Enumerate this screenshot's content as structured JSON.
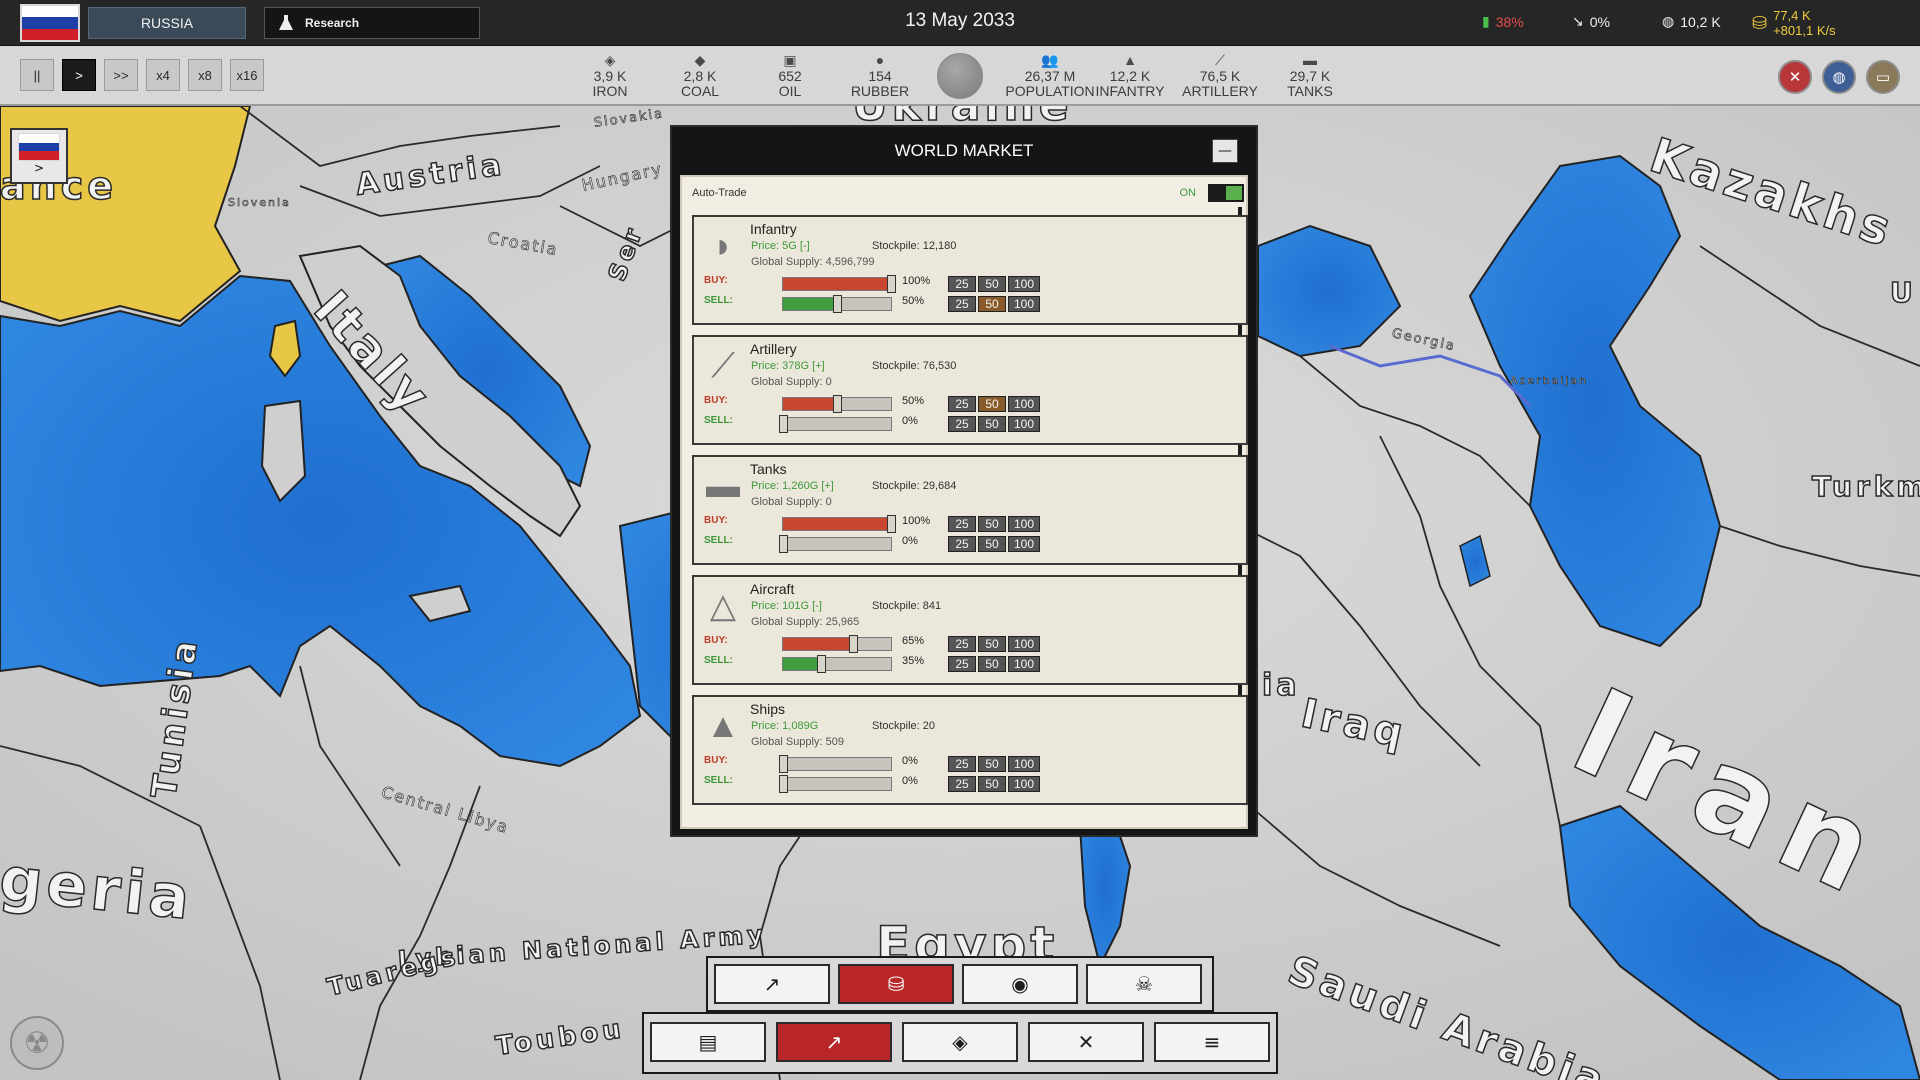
{
  "topbar": {
    "country": "RUSSIA",
    "research_label": "Research",
    "date": "13 May 2033",
    "territory": "38%",
    "growth": "0%",
    "population_short": "10,2 K",
    "money": "77,4 K",
    "money_rate": "+801,1 K/s",
    "colors": {
      "territory": "#e24c4c",
      "money": "#f0cc3a"
    }
  },
  "speed_controls": [
    "||",
    ">",
    ">>",
    "x4",
    "x8",
    "x16"
  ],
  "resources": [
    {
      "value": "3,9 K",
      "label": "IRON",
      "icon": "layers-icon"
    },
    {
      "value": "2,8 K",
      "label": "COAL",
      "icon": "gem-icon"
    },
    {
      "value": "652",
      "label": "OIL",
      "icon": "barrel-icon"
    },
    {
      "value": "154",
      "label": "RUBBER",
      "icon": "drop-icon"
    },
    {
      "value": "26,37 M",
      "label": "POPULATION",
      "icon": "people-icon"
    },
    {
      "value": "12,2 K",
      "label": "INFANTRY",
      "icon": "helmet-icon"
    },
    {
      "value": "76,5 K",
      "label": "ARTILLERY",
      "icon": "cannon-icon"
    },
    {
      "value": "29,7 K",
      "label": "TANKS",
      "icon": "tank-icon"
    }
  ],
  "side_flag": {
    "arrow": ">"
  },
  "map_labels": {
    "france": "ance",
    "austria": "Austria",
    "hungary": "Hungary",
    "slovakia": "Slovakia",
    "croatia": "Croatia",
    "serbia": "Ser",
    "italy": "Italy",
    "kazakhstan": "Kazakhs",
    "georgia": "Georgia",
    "azerbaijan": "Azerbaijan",
    "turkmenistan": "Turkm",
    "iraq": "Iraq",
    "iran": "Iran",
    "syria_frag": "ia",
    "tunisia": "Tunisia",
    "algeria": "geria",
    "central_libya": "Central Libya",
    "lna": "Lybian National Army",
    "tuaregs": "Tuaregs",
    "toubou": "Toubou",
    "egypt": "Egypt",
    "saudi": "Saudi Arabia",
    "ukraine_frag": "Ukraine",
    "slovenia": "Slovenia",
    "u_frag": "U"
  },
  "market": {
    "title": "WORLD MARKET",
    "close_label": "—",
    "auto_trade_label": "Auto-Trade",
    "auto_trade_state": "ON",
    "buy_label": "BUY:",
    "sell_label": "SELL:",
    "qty_buttons": [
      "25",
      "50",
      "100"
    ],
    "items": [
      {
        "name": "Infantry",
        "price": "Price: 5G [-]",
        "stockpile": "Stockpile: 12,180",
        "supply": "Global Supply: 4,596,799",
        "buy_pct": "100%",
        "buy_value": 100,
        "sell_pct": "50%",
        "sell_value": 50,
        "icon": "helmet-icon"
      },
      {
        "name": "Artillery",
        "price": "Price: 378G [+]",
        "stockpile": "Stockpile: 76,530",
        "supply": "Global Supply: 0",
        "buy_pct": "50%",
        "buy_value": 50,
        "sell_pct": "0%",
        "sell_value": 0,
        "icon": "cannon-icon"
      },
      {
        "name": "Tanks",
        "price": "Price: 1,260G [+]",
        "stockpile": "Stockpile: 29,684",
        "supply": "Global Supply: 0",
        "buy_pct": "100%",
        "buy_value": 100,
        "sell_pct": "0%",
        "sell_value": 0,
        "icon": "tank-icon"
      },
      {
        "name": "Aircraft",
        "price": "Price: 101G [-]",
        "stockpile": "Stockpile: 841",
        "supply": "Global Supply: 25,965",
        "buy_pct": "65%",
        "buy_value": 65,
        "sell_pct": "35%",
        "sell_value": 35,
        "icon": "aircraft-icon"
      },
      {
        "name": "Ships",
        "price": "Price: 1,089G",
        "stockpile": "Stockpile: 20",
        "supply": "Global Supply: 509",
        "buy_pct": "0%",
        "buy_value": 0,
        "sell_pct": "0%",
        "sell_value": 0,
        "icon": "ship-icon"
      }
    ]
  },
  "bottom_tabs_upper": [
    {
      "icon": "trend-icon",
      "active": false
    },
    {
      "icon": "market-icon",
      "active": true
    },
    {
      "icon": "eye-icon",
      "active": false
    },
    {
      "icon": "skull-icon",
      "active": false
    }
  ],
  "bottom_tabs_lower": [
    {
      "icon": "map-icon",
      "active": false
    },
    {
      "icon": "economy-icon",
      "active": true
    },
    {
      "icon": "diplomacy-icon",
      "active": false
    },
    {
      "icon": "war-icon",
      "active": false
    },
    {
      "icon": "menu-icon",
      "active": false
    }
  ]
}
